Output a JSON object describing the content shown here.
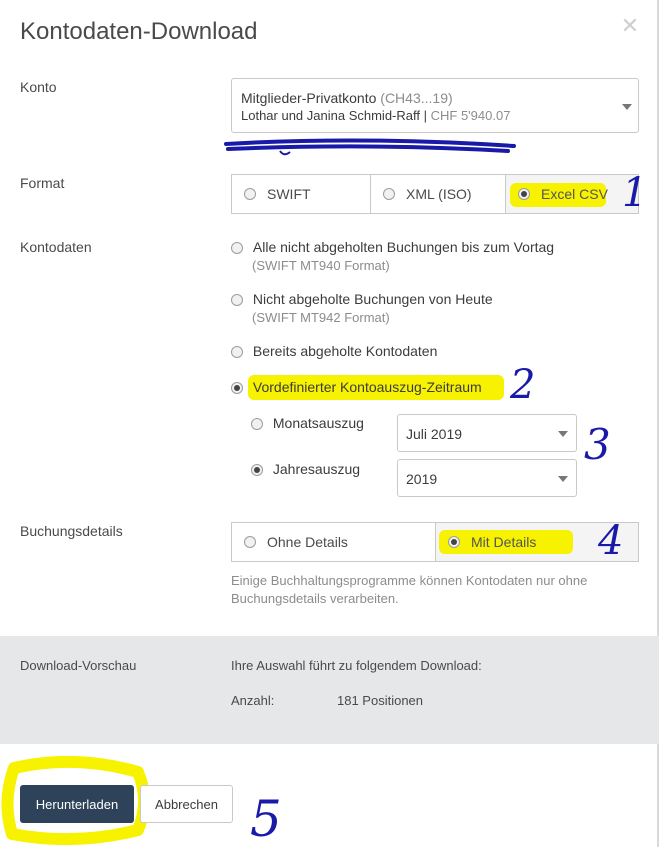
{
  "dialog": {
    "title": "Kontodaten-Download",
    "close_icon": "close-icon"
  },
  "account": {
    "label": "Konto",
    "name": "Mitglieder-Privatkonto",
    "iban_short": "(CH43...19)",
    "holder": "Lothar und Janina Schmid-Raff",
    "separator": "|",
    "balance": "CHF 5'940.07"
  },
  "format": {
    "label": "Format",
    "options": [
      "SWIFT",
      "XML (ISO)",
      "Excel CSV"
    ],
    "selected": "Excel CSV"
  },
  "kontodaten": {
    "label": "Kontodaten",
    "options": [
      {
        "label": "Alle nicht abgeholten Buchungen bis zum Vortag",
        "sub": "(SWIFT MT940 Format)"
      },
      {
        "label": "Nicht abgeholte Buchungen von Heute",
        "sub": "(SWIFT MT942 Format)"
      },
      {
        "label": "Bereits abgeholte Kontodaten",
        "sub": ""
      },
      {
        "label": "Vordefinierter Kontoauszug-Zeitraum",
        "sub": ""
      }
    ],
    "period": {
      "monthly_label": "Monatsauszug",
      "monthly_value": "Juli 2019",
      "yearly_label": "Jahresauszug",
      "yearly_value": "2019"
    }
  },
  "booking_details": {
    "label": "Buchungsdetails",
    "options": [
      "Ohne Details",
      "Mit Details"
    ],
    "selected": "Mit Details",
    "hint": "Einige Buchhaltungsprogramme können Kontodaten nur ohne Buchungsdetails verarbeiten."
  },
  "preview": {
    "label": "Download-Vorschau",
    "intro": "Ihre Auswahl führt zu folgendem Download:",
    "count_label": "Anzahl:",
    "count_value": "181 Positionen"
  },
  "actions": {
    "download": "Herunterladen",
    "cancel": "Abbrechen"
  },
  "annotations": [
    "1",
    "2",
    "3",
    "4",
    "5"
  ],
  "colors": {
    "highlight": "#f6f200",
    "primary": "#2e4259",
    "annotation_ink": "#1a1aa8",
    "band": "#e6e7e9"
  }
}
